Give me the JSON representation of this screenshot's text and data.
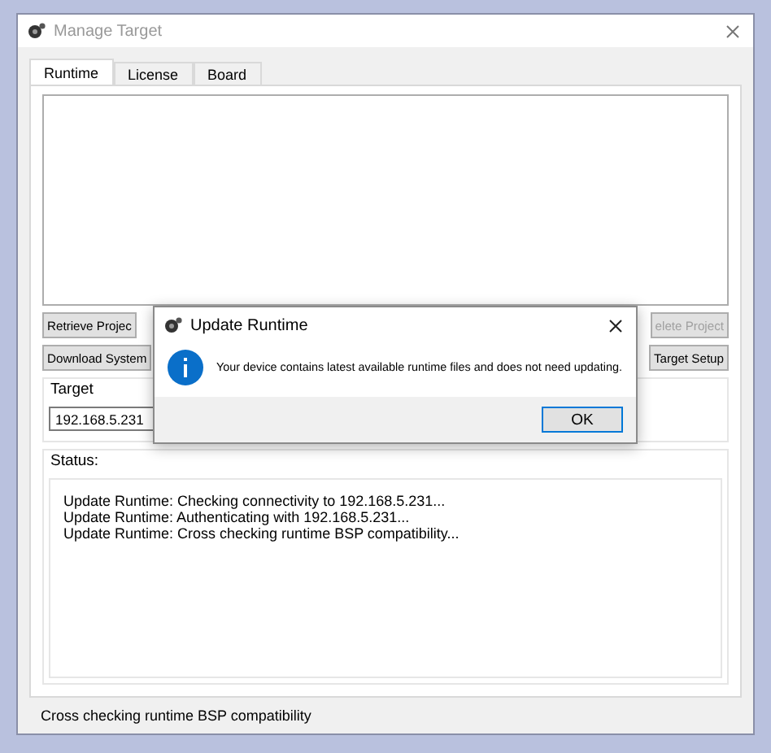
{
  "window": {
    "title": "Manage Target"
  },
  "tabs": [
    {
      "label": "Runtime",
      "selected": true
    },
    {
      "label": "License",
      "selected": false
    },
    {
      "label": "Board",
      "selected": false
    }
  ],
  "button_rows": [
    {
      "left": {
        "label": "Retrieve Projec",
        "disabled": false
      },
      "right": {
        "label": "elete Project",
        "disabled": true
      }
    },
    {
      "left": {
        "label": "Download System",
        "disabled": false
      },
      "right": {
        "label": "Target Setup",
        "disabled": false
      }
    }
  ],
  "target": {
    "label": "Target",
    "value": "192.168.5.231"
  },
  "status": {
    "label": "Status:",
    "lines": [
      "Update Runtime: Checking connectivity to 192.168.5.231...",
      "Update Runtime: Authenticating with 192.168.5.231...",
      "Update Runtime: Cross checking runtime BSP compatibility..."
    ]
  },
  "status_bar": "Cross checking runtime BSP compatibility",
  "dialog": {
    "title": "Update Runtime",
    "message": "Your device contains latest available runtime files and does not need updating.",
    "buttons": [
      "OK"
    ]
  }
}
